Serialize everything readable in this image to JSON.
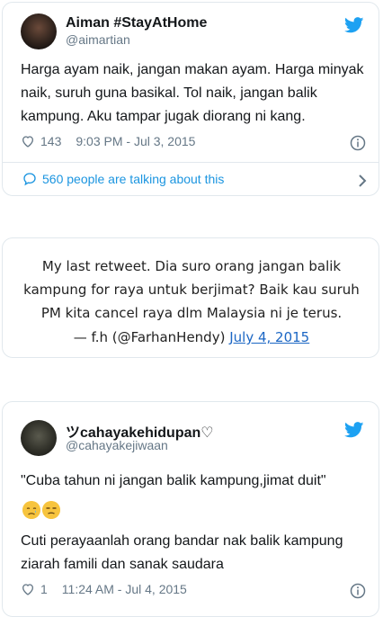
{
  "tweet1": {
    "display_name": "Aiman #StayAtHome",
    "handle": "@aimartian",
    "text": "Harga ayam naik, jangan makan ayam. Harga minyak naik, suruh guna basikal. Tol naik, jangan balik kampung. Aku tampar jugak diorang ni kang.",
    "likes": "143",
    "timestamp": "9:03 PM - Jul 3, 2015",
    "talking": "560 people are talking about this"
  },
  "quote": {
    "text": "My last retweet. Dia suro orang jangan balik kampung for raya untuk berjimat? Baik kau suruh PM kita cancel raya dlm Malaysia ni je terus.",
    "attribution": "— f.h (@FarhanHendy)",
    "date_link": "July 4, 2015"
  },
  "tweet2": {
    "display_name": "ツcahayakehidupan♡",
    "handle": "@cahayakejiwaan",
    "text": "\"Cuba tahun ni jangan balik kampung,jimat duit\"",
    "emojis": [
      "sad-relieved-face",
      "unamused-face"
    ],
    "text2": "Cuti perayaanlah orang bandar nak balik kampung ziarah famili dan sanak saudara",
    "likes": "1",
    "timestamp": "11:24 AM - Jul 4, 2015"
  },
  "colors": {
    "twitter_blue": "#1da1f2",
    "link_blue": "#1b95e0",
    "muted": "#657786",
    "border": "#e1e8ed"
  }
}
